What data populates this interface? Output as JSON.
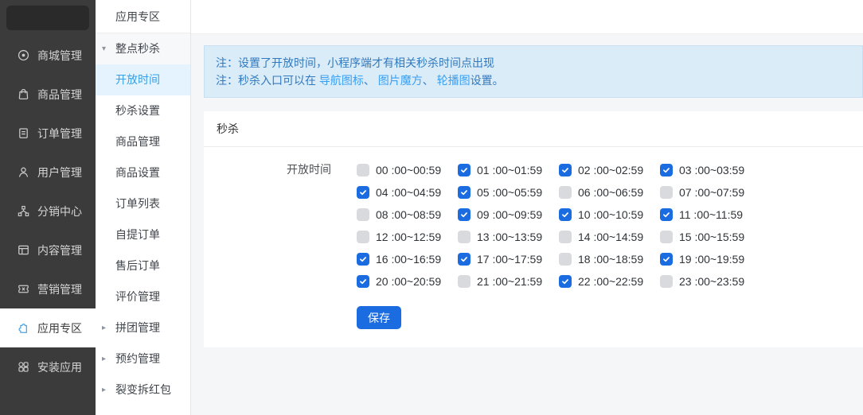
{
  "colors": {
    "primary": "#1a6ce0",
    "sidebar_bg": "#3b3b3b",
    "submenu_active_bg": "#e4f3fd",
    "submenu_active_text": "#36a0e8",
    "notice_bg": "#d9ecf8",
    "notice_text": "#3279be",
    "notice_link": "#3b9ff2"
  },
  "sidebar": {
    "items": [
      {
        "id": "shop",
        "label": "商城管理",
        "icon": "target-icon",
        "active": false
      },
      {
        "id": "goods",
        "label": "商品管理",
        "icon": "bag-icon",
        "active": false
      },
      {
        "id": "orders",
        "label": "订单管理",
        "icon": "clipboard-icon",
        "active": false
      },
      {
        "id": "users",
        "label": "用户管理",
        "icon": "user-icon",
        "active": false
      },
      {
        "id": "distribution",
        "label": "分销中心",
        "icon": "network-icon",
        "active": false
      },
      {
        "id": "content",
        "label": "内容管理",
        "icon": "layout-icon",
        "active": false
      },
      {
        "id": "marketing",
        "label": "营销管理",
        "icon": "ticket-icon",
        "active": false
      },
      {
        "id": "apps",
        "label": "应用专区",
        "icon": "puzzle-icon",
        "active": true
      },
      {
        "id": "install",
        "label": "安装应用",
        "icon": "grid-icon",
        "active": false
      }
    ]
  },
  "submenu": {
    "header": "应用专区",
    "items": [
      {
        "id": "flash-sale",
        "label": "整点秒杀",
        "arrow": "down",
        "tinted": true
      },
      {
        "id": "open-time",
        "label": "开放时间",
        "active": true
      },
      {
        "id": "seckill-settings",
        "label": "秒杀设置"
      },
      {
        "id": "goods-manage",
        "label": "商品管理"
      },
      {
        "id": "goods-settings",
        "label": "商品设置"
      },
      {
        "id": "order-list",
        "label": "订单列表"
      },
      {
        "id": "pickup-orders",
        "label": "自提订单"
      },
      {
        "id": "aftersale-orders",
        "label": "售后订单"
      },
      {
        "id": "review-manage",
        "label": "评价管理"
      },
      {
        "id": "group-buy",
        "label": "拼团管理",
        "arrow": "right"
      },
      {
        "id": "booking",
        "label": "预约管理",
        "arrow": "right"
      },
      {
        "id": "red-packet",
        "label": "裂变拆红包",
        "arrow": "right"
      }
    ]
  },
  "notice": {
    "line1": "注：设置了开放时间，小程序端才有相关秒杀时间点出现",
    "line2_segments": [
      {
        "text": "注：秒杀入口可以在 "
      },
      {
        "id": "nav-icon",
        "text": "导航图标",
        "link": true
      },
      {
        "text": "、 "
      },
      {
        "id": "image-cube",
        "text": "图片魔方",
        "link": true
      },
      {
        "text": "、 "
      },
      {
        "id": "carousel",
        "text": "轮播图",
        "link": true
      },
      {
        "text": "设置。"
      }
    ]
  },
  "panel": {
    "title": "秒杀",
    "field_label": "开放时间",
    "save_label": "保存",
    "time_slots": [
      {
        "label": "00 :00~00:59",
        "checked": false
      },
      {
        "label": "01 :00~01:59",
        "checked": true
      },
      {
        "label": "02 :00~02:59",
        "checked": true
      },
      {
        "label": "03 :00~03:59",
        "checked": true
      },
      {
        "label": "04 :00~04:59",
        "checked": true
      },
      {
        "label": "05 :00~05:59",
        "checked": true
      },
      {
        "label": "06 :00~06:59",
        "checked": false
      },
      {
        "label": "07 :00~07:59",
        "checked": false
      },
      {
        "label": "08 :00~08:59",
        "checked": false
      },
      {
        "label": "09 :00~09:59",
        "checked": true
      },
      {
        "label": "10 :00~10:59",
        "checked": true
      },
      {
        "label": "11 :00~11:59",
        "checked": true
      },
      {
        "label": "12 :00~12:59",
        "checked": false
      },
      {
        "label": "13 :00~13:59",
        "checked": false
      },
      {
        "label": "14 :00~14:59",
        "checked": false
      },
      {
        "label": "15 :00~15:59",
        "checked": false
      },
      {
        "label": "16 :00~16:59",
        "checked": true
      },
      {
        "label": "17 :00~17:59",
        "checked": true
      },
      {
        "label": "18 :00~18:59",
        "checked": false
      },
      {
        "label": "19 :00~19:59",
        "checked": true
      },
      {
        "label": "20 :00~20:59",
        "checked": true
      },
      {
        "label": "21 :00~21:59",
        "checked": false
      },
      {
        "label": "22 :00~22:59",
        "checked": true
      },
      {
        "label": "23 :00~23:59",
        "checked": false
      }
    ]
  }
}
